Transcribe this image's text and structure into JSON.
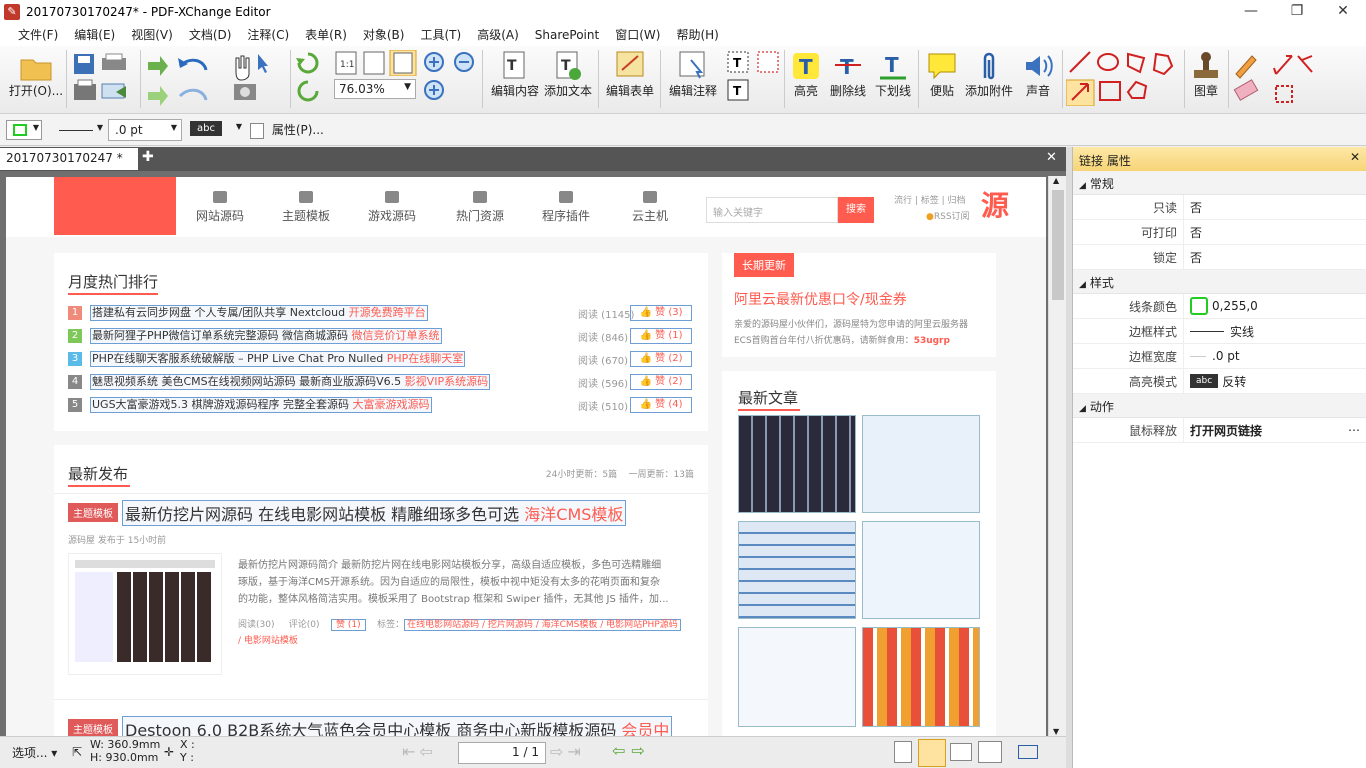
{
  "window": {
    "title": "20170730170247* - PDF-XChange Editor"
  },
  "menu": [
    "文件(F)",
    "编辑(E)",
    "视图(V)",
    "文档(D)",
    "注释(C)",
    "表单(R)",
    "对象(B)",
    "工具(T)",
    "高级(A)",
    "SharePoint",
    "窗口(W)",
    "帮助(H)"
  ],
  "toolbar": {
    "open": "打开(O)...",
    "zoom": "76.03%",
    "edit_content": "编辑内容",
    "add_text": "添加文本",
    "edit_form": "编辑表单",
    "edit_annot": "编辑注释",
    "highlight": "高亮",
    "strikeout": "删除线",
    "underline": "下划线",
    "note": "便贴",
    "attach": "添加附件",
    "sound": "声音",
    "stamp": "图章"
  },
  "propbar": {
    "line_width": ".0 pt",
    "text_style": "abc",
    "props": "属性(P)..."
  },
  "tab": {
    "label": "20170730170247 *"
  },
  "panel": {
    "title": "链接 属性",
    "sections": [
      {
        "name": "常规",
        "rows": [
          {
            "k": "只读",
            "v": "否"
          },
          {
            "k": "可打印",
            "v": "否"
          },
          {
            "k": "锁定",
            "v": "否"
          }
        ]
      },
      {
        "name": "样式",
        "rows": [
          {
            "k": "线条颜色",
            "v": "0,255,0"
          },
          {
            "k": "边框样式",
            "v": "实线"
          },
          {
            "k": "边框宽度",
            "v": ".0 pt"
          },
          {
            "k": "高亮模式",
            "v": "反转"
          }
        ]
      },
      {
        "name": "动作",
        "rows": [
          {
            "k": "鼠标释放",
            "v": "打开网页链接"
          }
        ]
      }
    ],
    "line_color": "#22cc22"
  },
  "status": {
    "options": "选项...",
    "w": "W: 360.9mm",
    "h": "H: 930.0mm",
    "x": "X :",
    "y": "Y :",
    "page": "1 / 1"
  },
  "site": {
    "nav": [
      "网站源码",
      "主题模板",
      "游戏源码",
      "热门资源",
      "程序插件",
      "云主机"
    ],
    "search_placeholder": "输入关键字",
    "search_btn": "搜索",
    "links": "流行 | 标签 | 归档",
    "rss": "RSS订阅",
    "logo_char": "源",
    "rank_title": "月度热门排行",
    "ranks": [
      {
        "n": "1",
        "t": "搭建私有云同步网盘 个人专属/团队共享 Nextcloud ",
        "r": "开源免费跨平台",
        "v": "阅读 (1145)",
        "l": "赞 (3)",
        "c": "#f08a7a"
      },
      {
        "n": "2",
        "t": "最新阿狸子PHP微信订单系统完整源码 微信商城源码 ",
        "r": "微信竞价订单系统",
        "v": "阅读 (846)",
        "l": "赞 (1)",
        "c": "#7ec85a"
      },
      {
        "n": "3",
        "t": "PHP在线聊天客服系统破解版 – PHP Live Chat Pro Nulled ",
        "r": "PHP在线聊天室",
        "v": "阅读 (670)",
        "l": "赞 (2)",
        "c": "#5bbbe8"
      },
      {
        "n": "4",
        "t": "魅思视频系统 美色CMS在线视频网站源码 最新商业版源码V6.5 ",
        "r": "影视VIP系统源码",
        "v": "阅读 (596)",
        "l": "赞 (2)",
        "c": "#888"
      },
      {
        "n": "5",
        "t": "UGS大富豪游戏5.3 棋牌游戏源码程序 完整全套源码 ",
        "r": "大富豪游戏源码",
        "v": "阅读 (510)",
        "l": "赞 (4)",
        "c": "#888"
      }
    ],
    "promo_tag": "长期更新",
    "promo_title": "阿里云最新优惠口令/现金券",
    "promo_text1": "亲爱的源码屋小伙伴们，源码屋特为您申请的阿里云服务器",
    "promo_text2": "ECS首购首台年付八折优惠码，请新鲜食用：",
    "promo_code": "53ugrp",
    "latest_title": "最新发布",
    "latest_stats": "24小时更新：5篇    一周更新：13篇",
    "post1": {
      "tag": "主题模板",
      "t": "最新仿挖片网源码 在线电影网站模板 精雕细琢多色可选 ",
      "r": "海洋CMS模板",
      "meta": "源码屋 发布于 15小时前",
      "desc1": "最新仿挖片网源码简介 最新防挖片网在线电影网站模板分享，高级自适应模板，多色可选精雕细",
      "desc2": "琢版，基于海洋CMS开源系统。因为自适应的局限性，模板中视中矩没有太多的花哨页面和复杂",
      "desc3": "的功能，整体风格简洁实用。模板采用了 Bootstrap 框架和 Swiper 插件，无其他 JS 插件，加...",
      "read": "阅读(30)",
      "comment": "评论(0)",
      "like": "赞 (1)",
      "tags_label": "标签：",
      "tags": "在线电影网站源码 / 挖片网源码 / 海洋CMS模板 / 电影网站PHP源码",
      "tags2": "/ 电影网站模板"
    },
    "post2": {
      "tag": "主题模板",
      "t": "Destoon 6.0 B2B系统大气蓝色会员中心模板 商务中心新版模板源码 ",
      "r": "会员中"
    },
    "articles_title": "最新文章"
  }
}
